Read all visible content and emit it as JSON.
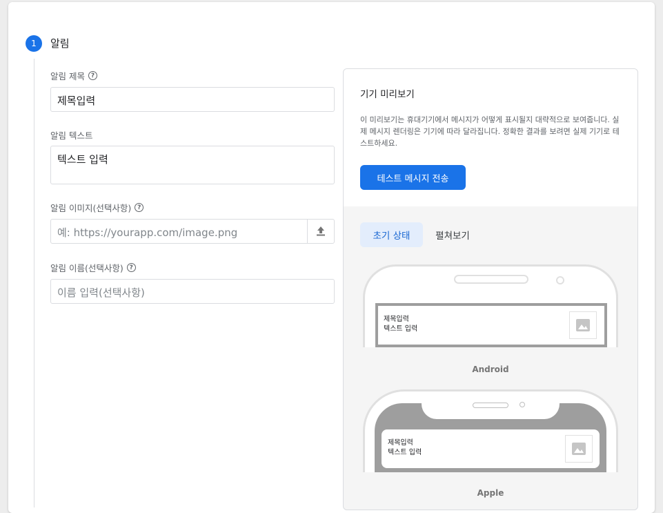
{
  "step": {
    "number": "1",
    "title": "알림"
  },
  "form": {
    "title_label": "알림 제목",
    "title_value": "제목입력",
    "text_label": "알림 텍스트",
    "text_value": "텍스트 입력",
    "image_label": "알림 이미지(선택사항)",
    "image_placeholder": "예: https://yourapp.com/image.png",
    "name_label": "알림 이름(선택사항)",
    "name_placeholder": "이름 입력(선택사항)",
    "help_glyph": "?"
  },
  "preview": {
    "title": "기기 미리보기",
    "description": "이 미리보기는 휴대기기에서 메시지가 어떻게 표시될지 대략적으로 보여줍니다. 실제 메시지 렌더링은 기기에 따라 달라집니다. 정확한 결과를 보려면 실제 기기로 테스트하세요.",
    "send_button": "테스트 메시지 전송",
    "tabs": [
      {
        "label": "초기 상태",
        "active": true
      },
      {
        "label": "펼쳐보기",
        "active": false
      }
    ],
    "android": {
      "label": "Android",
      "notif_title": "제목입력",
      "notif_text": "텍스트 입력"
    },
    "apple": {
      "label": "Apple",
      "notif_title": "제목입력",
      "notif_text": "텍스트 입력"
    }
  },
  "colors": {
    "accent": "#1a73e8",
    "tab_active_bg": "#e3edfc",
    "preview_bg": "#f5f5f5"
  }
}
